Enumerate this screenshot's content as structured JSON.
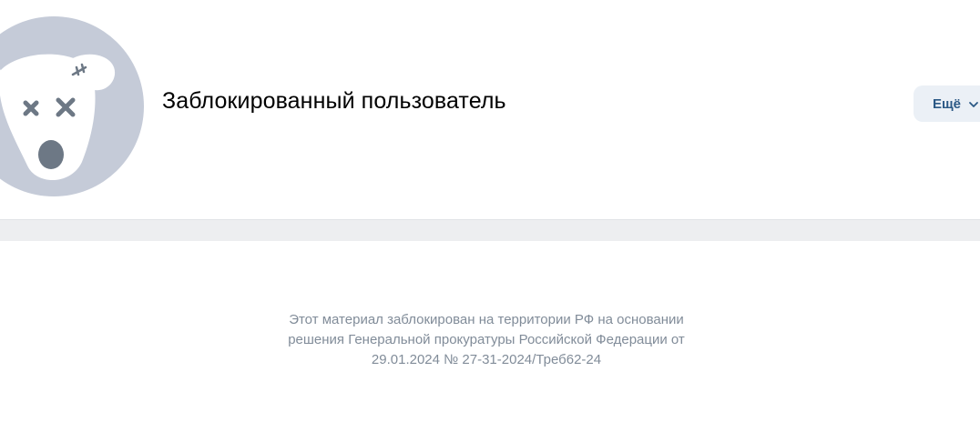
{
  "profile": {
    "name": "Заблокированный пользователь",
    "avatar_icon": "blocked-dog-icon",
    "more_label": "Ещё",
    "more_icon": "chevron-down-icon"
  },
  "notice": {
    "line1": "Этот материал заблокирован на территории РФ на основании",
    "line2": "решения Генеральной прокуратуры Российской Федерации от",
    "line3": "29.01.2024 № 27-31-2024/Треб62-24"
  },
  "colors": {
    "avatar_bg": "#c5cbd8",
    "button_bg": "#ebf0f6",
    "muted_text": "#818c99",
    "separator": "#edeef0"
  }
}
